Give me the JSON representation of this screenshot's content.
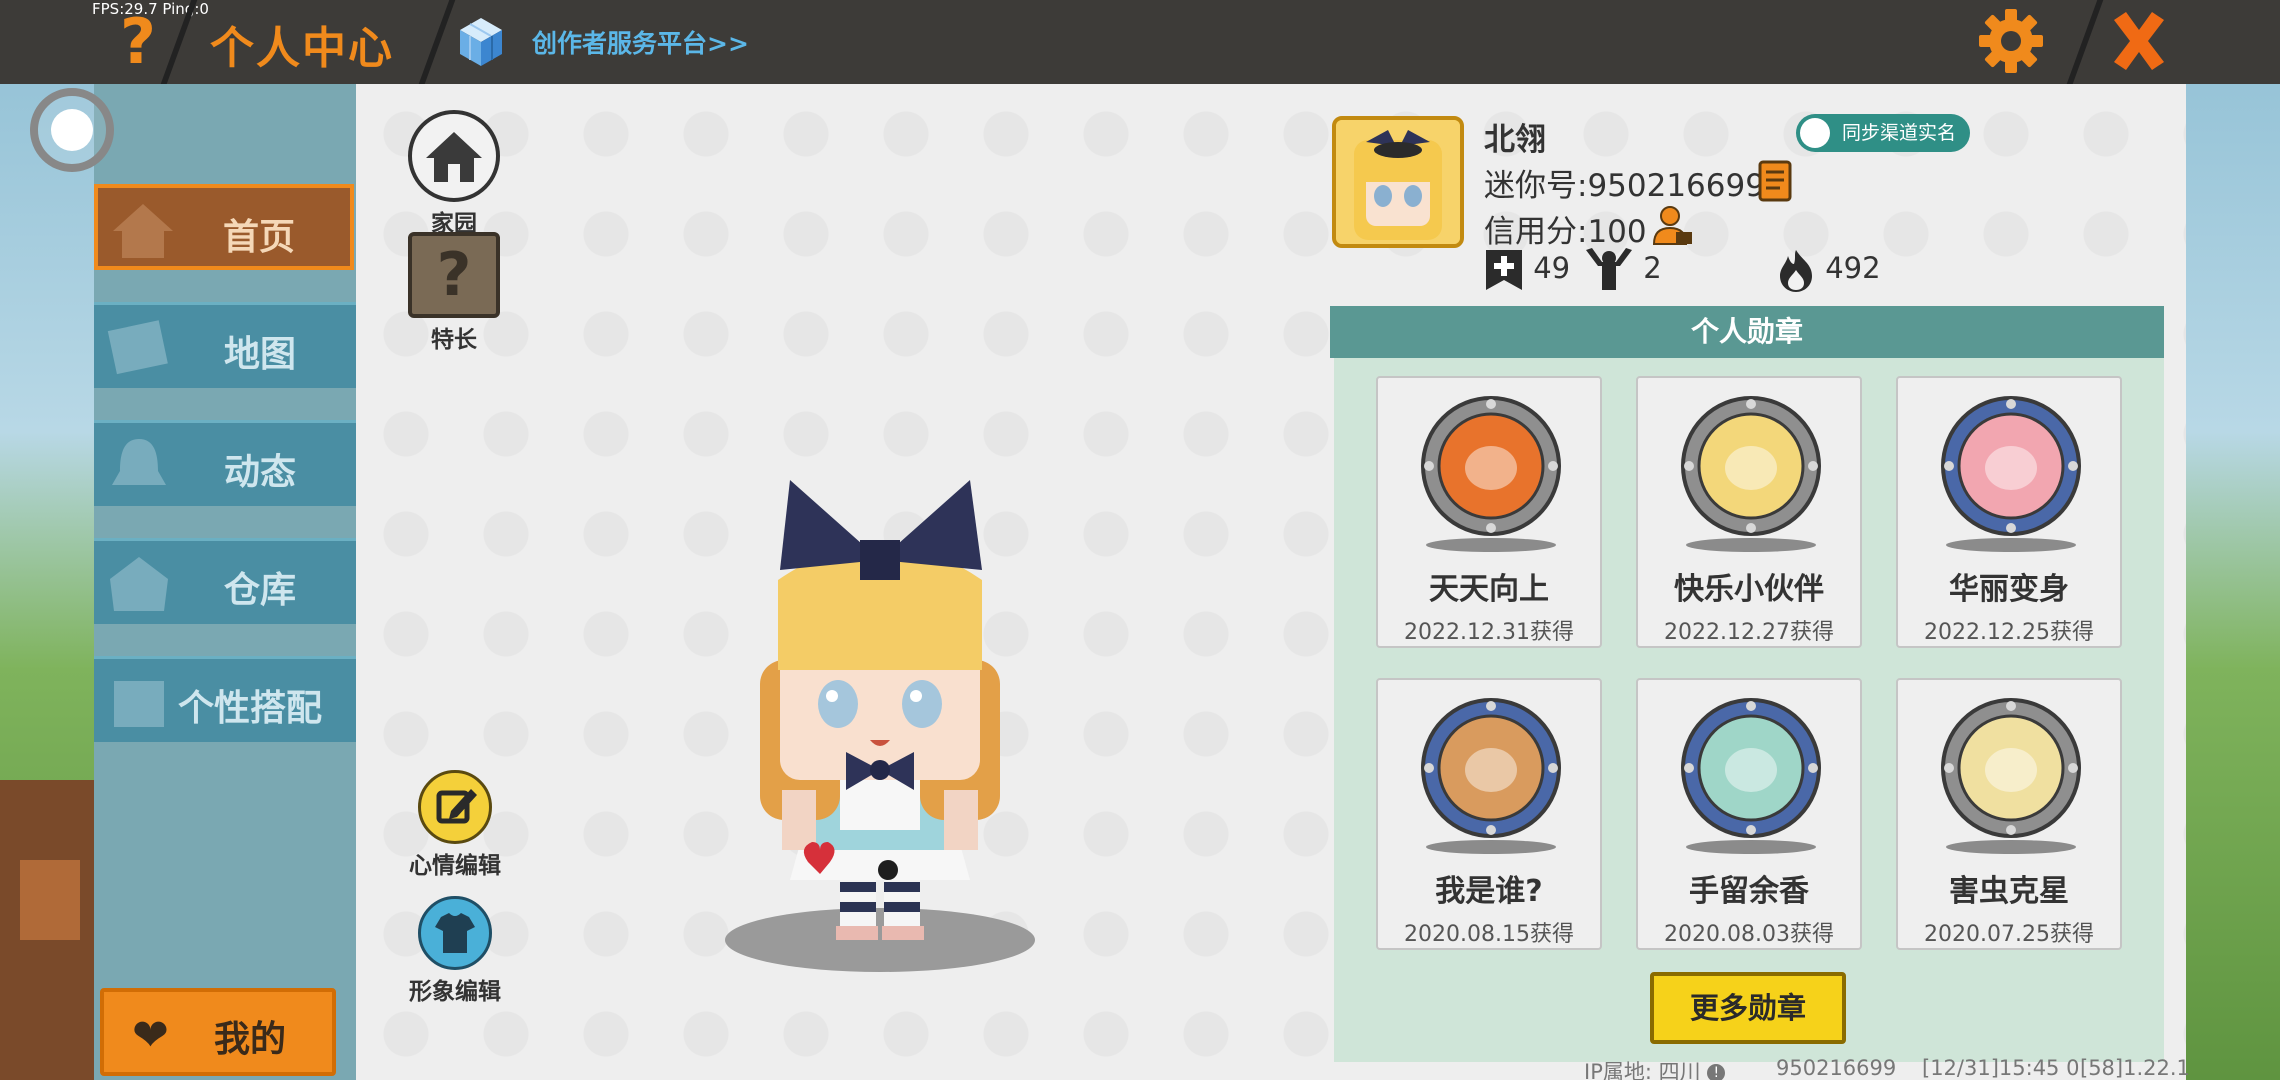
{
  "debug": {
    "fps_text": "FPS:29.7  Ping:0"
  },
  "header": {
    "help_glyph": "?",
    "title": "个人中心",
    "creator_link": "创作者服务平台>>"
  },
  "sidebar": {
    "items": [
      {
        "label": "首页",
        "icon": "house-icon",
        "active": true
      },
      {
        "label": "地图",
        "icon": "map-icon"
      },
      {
        "label": "动态",
        "icon": "bell-icon"
      },
      {
        "label": "仓库",
        "icon": "warehouse-icon"
      },
      {
        "label": "个性搭配",
        "icon": "outfit-icon"
      }
    ],
    "mine_label": "我的",
    "mine_glyph": "❤"
  },
  "shortcuts": {
    "home": "家园",
    "talent": "特长",
    "talent_glyph": "?",
    "mood": "心情编辑",
    "look": "形象编辑"
  },
  "profile": {
    "name": "北翎",
    "mini_id": "迷你号:950216699",
    "credit": "信用分:100",
    "sync_badge": "同步渠道实名",
    "stats": {
      "friends": "49",
      "fans": "2",
      "popularity": "492"
    }
  },
  "medals": {
    "header": "个人勋章",
    "items": [
      {
        "name": "天天向上",
        "date": "2022.12.31获得",
        "icon": "calendar-medal-icon",
        "rim": "#8f8f8f",
        "face": "#e8732c"
      },
      {
        "name": "快乐小伙伴",
        "date": "2022.12.27获得",
        "icon": "friends-medal-icon",
        "rim": "#8f8f8f",
        "face": "#f3d77a"
      },
      {
        "name": "华丽变身",
        "date": "2022.12.25获得",
        "icon": "transform-medal-icon",
        "rim": "#4a68a8",
        "face": "#f2a6b0"
      },
      {
        "name": "我是谁?",
        "date": "2020.08.15获得",
        "icon": "card-medal-icon",
        "rim": "#4a68a8",
        "face": "#d99b5e"
      },
      {
        "name": "手留余香",
        "date": "2020.08.03获得",
        "icon": "flower-medal-icon",
        "rim": "#4a68a8",
        "face": "#9fd6c8"
      },
      {
        "name": "害虫克星",
        "date": "2020.07.25获得",
        "icon": "bug-medal-icon",
        "rim": "#8f8f8f",
        "face": "#f0e0a0"
      }
    ],
    "more_label": "更多勋章"
  },
  "footer": {
    "ip": "IP属地: 四川",
    "uid": "950216699",
    "time": "[12/31]15:45 0",
    "version": "[58]1.22.1"
  },
  "colors": {
    "accent": "#f08a1c",
    "nav": "#4a8ea3",
    "medal_header": "#5a9893"
  }
}
